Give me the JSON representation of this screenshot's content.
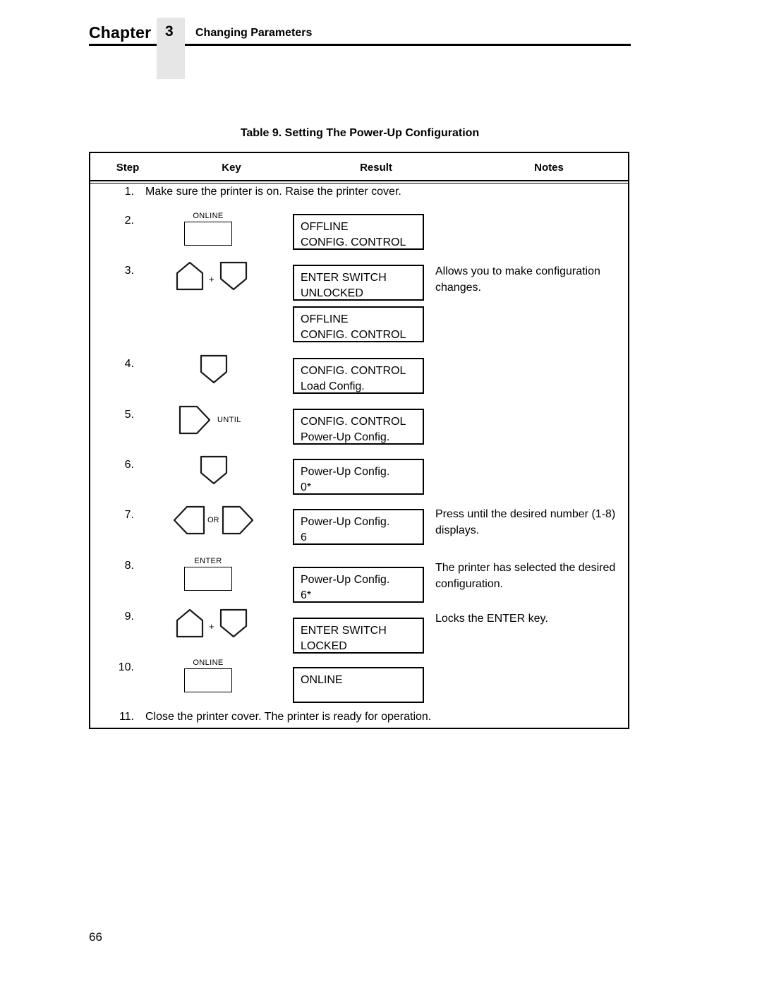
{
  "header": {
    "chapter_word": "Chapter",
    "chapter_number": "3",
    "chapter_title": "Changing Parameters"
  },
  "table": {
    "caption": "Table 9. Setting The Power-Up Configuration",
    "columns": [
      "Step",
      "Key",
      "Result",
      "Notes"
    ],
    "rows": [
      {
        "step": "1.",
        "full_text": "Make sure the printer is on. Raise the printer cover.",
        "keys": [],
        "result": [],
        "notes": ""
      },
      {
        "step": "2.",
        "full_text": "",
        "keys": [
          {
            "type": "rect",
            "label": "ONLINE"
          }
        ],
        "result": [
          "OFFLINE",
          "CONFIG. CONTROL"
        ],
        "notes": ""
      },
      {
        "step": "3.",
        "full_text": "",
        "keys": [
          {
            "type": "up"
          },
          {
            "type": "joiner",
            "label": "+"
          },
          {
            "type": "down"
          }
        ],
        "result": [
          "ENTER SWITCH",
          "UNLOCKED"
        ],
        "result2": [
          "OFFLINE",
          "CONFIG. CONTROL"
        ],
        "notes": "Allows you to make configuration changes."
      },
      {
        "step": "4.",
        "full_text": "",
        "keys": [
          {
            "type": "down"
          }
        ],
        "result": [
          "CONFIG. CONTROL",
          "Load Config."
        ],
        "notes": ""
      },
      {
        "step": "5.",
        "full_text": "",
        "keys": [
          {
            "type": "right"
          },
          {
            "type": "sidelabel",
            "label": "UNTIL"
          }
        ],
        "result": [
          "CONFIG. CONTROL",
          "Power-Up Config."
        ],
        "notes": ""
      },
      {
        "step": "6.",
        "full_text": "",
        "keys": [
          {
            "type": "down"
          }
        ],
        "result": [
          "Power-Up Config.",
          "0*"
        ],
        "notes": ""
      },
      {
        "step": "7.",
        "full_text": "",
        "keys": [
          {
            "type": "left"
          },
          {
            "type": "joiner",
            "label": "OR"
          },
          {
            "type": "right"
          }
        ],
        "result": [
          "Power-Up Config.",
          "6"
        ],
        "notes": "Press until the desired number (1-8) displays."
      },
      {
        "step": "8.",
        "full_text": "",
        "keys": [
          {
            "type": "rect",
            "label": "ENTER"
          }
        ],
        "result": [
          "Power-Up Config.",
          "6*"
        ],
        "notes": "The printer has selected the desired configuration."
      },
      {
        "step": "9.",
        "full_text": "",
        "keys": [
          {
            "type": "up"
          },
          {
            "type": "joiner",
            "label": "+"
          },
          {
            "type": "down"
          }
        ],
        "result": [
          "ENTER SWITCH",
          "LOCKED"
        ],
        "notes": "Locks the ENTER key."
      },
      {
        "step": "10.",
        "full_text": "",
        "keys": [
          {
            "type": "rect",
            "label": "ONLINE"
          }
        ],
        "result": [
          "ONLINE",
          ""
        ],
        "notes": ""
      },
      {
        "step": "11.",
        "full_text": "Close the printer cover. The printer is ready for operation.",
        "keys": [],
        "result": [],
        "notes": ""
      }
    ]
  },
  "footer": {
    "page_number": "66"
  }
}
